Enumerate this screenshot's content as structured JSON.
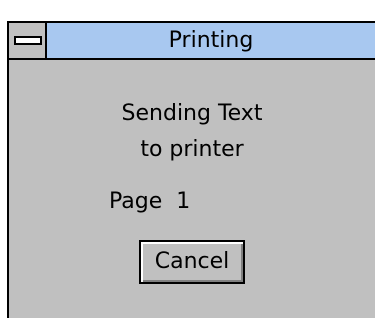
{
  "dialog": {
    "title": "Printing",
    "message_line1": "Sending Text",
    "message_line2": "to printer",
    "page_label": "Page",
    "page_number": "1",
    "cancel_label": "Cancel"
  },
  "colors": {
    "titlebar": "#a8c8f0",
    "background": "#c0c0c0"
  },
  "icons": {
    "system_menu": "system-menu-icon"
  }
}
